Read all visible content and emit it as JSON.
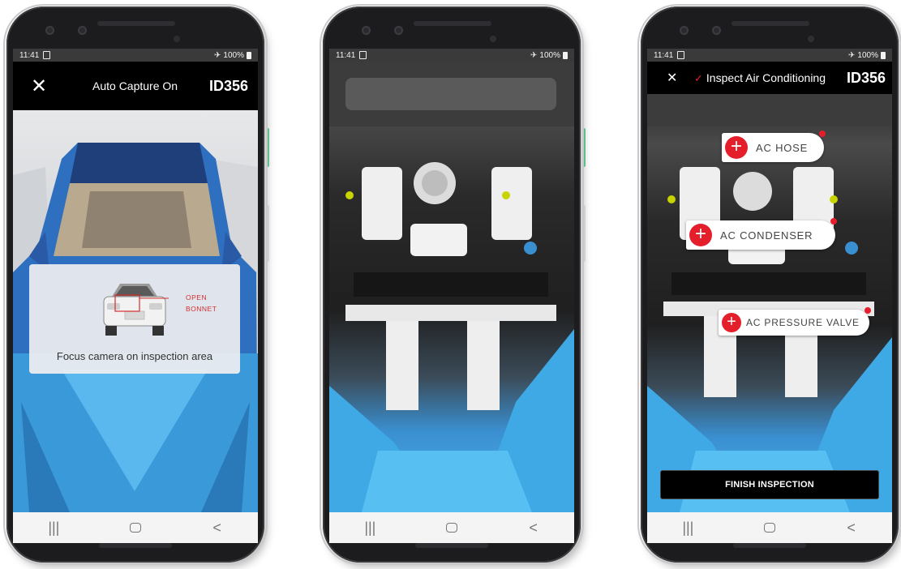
{
  "status_bar": {
    "time": "11:41",
    "battery": "100%"
  },
  "screen1": {
    "title": "Auto Capture On",
    "vehicle_id": "ID356",
    "overlay_caption": "Focus camera on inspection area",
    "open_label_line1": "OPEN",
    "open_label_line2": "BONNET"
  },
  "screen3": {
    "title": "Inspect Air Conditioning",
    "vehicle_id": "ID356",
    "tags": [
      {
        "label": "AC HOSE"
      },
      {
        "label": "AC CONDENSER"
      },
      {
        "label": "AC PRESSURE VALVE"
      }
    ],
    "finish_button": "FINISH INSPECTION"
  },
  "nav": {
    "recents_glyph": "|||",
    "back_glyph": "<"
  },
  "colors": {
    "accent_red": "#e41e2b",
    "app_bar": "#000000",
    "lego_blue": "#3a9ad9"
  },
  "icons": {
    "close": "close-icon",
    "check": "check-icon",
    "plus": "plus-icon",
    "airplane": "airplane-icon"
  }
}
